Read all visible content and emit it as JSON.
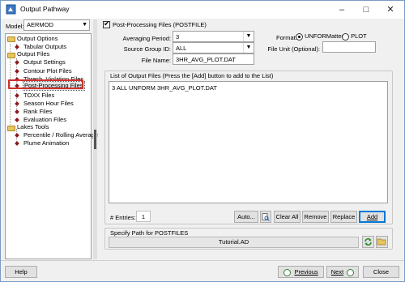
{
  "window": {
    "title": "Output Pathway"
  },
  "model": {
    "label": "Model:",
    "value": "AERMOD"
  },
  "tree": {
    "output_options": "Output Options",
    "tabular_outputs": "Tabular Outputs",
    "output_files": "Output Files",
    "output_settings": "Output Settings",
    "contour_plot_files": "Contour Plot Files",
    "thresh_violation_files": "Thresh. Violation Files",
    "post_processing_files": "Post-Processing Files",
    "toxx_files": "TOXX Files",
    "season_hour_files": "Season Hour Files",
    "rank_files": "Rank Files",
    "evaluation_files": "Evaluation Files",
    "lakes_tools": "Lakes Tools",
    "percentile_rolling_average": "Percentile / Rolling Average",
    "plume_animation": "Plume Animation"
  },
  "postfile": {
    "checkbox_label": "Post-Processing Files (POSTFILE)",
    "averaging_period_label": "Averaging Period:",
    "averaging_period_value": "3",
    "source_group_label": "Source Group ID:",
    "source_group_value": "ALL",
    "file_name_label": "File Name:",
    "file_name_value": "3HR_AVG_PLOT.DAT",
    "format_label": "Format:",
    "format_unformatted": "UNFORMatted",
    "format_plot": "PLOT",
    "file_unit_label": "File Unit (Optional):",
    "file_unit_value": ""
  },
  "list": {
    "caption": "List of Output Files (Press the [Add] button to add to the List)",
    "rows": [
      "3 ALL UNFORM 3HR_AVG_PLOT.DAT"
    ],
    "entries_label": "# Entries:",
    "entries_value": "1"
  },
  "buttons": {
    "auto": "Auto...",
    "clear_all": "Clear All",
    "remove": "Remove",
    "replace": "Replace",
    "add": "Add",
    "help": "Help",
    "previous": "Previous",
    "next": "Next",
    "close": "Close"
  },
  "path": {
    "caption": "Specify Path for POSTFILES",
    "value": "Tutorial.AD"
  }
}
